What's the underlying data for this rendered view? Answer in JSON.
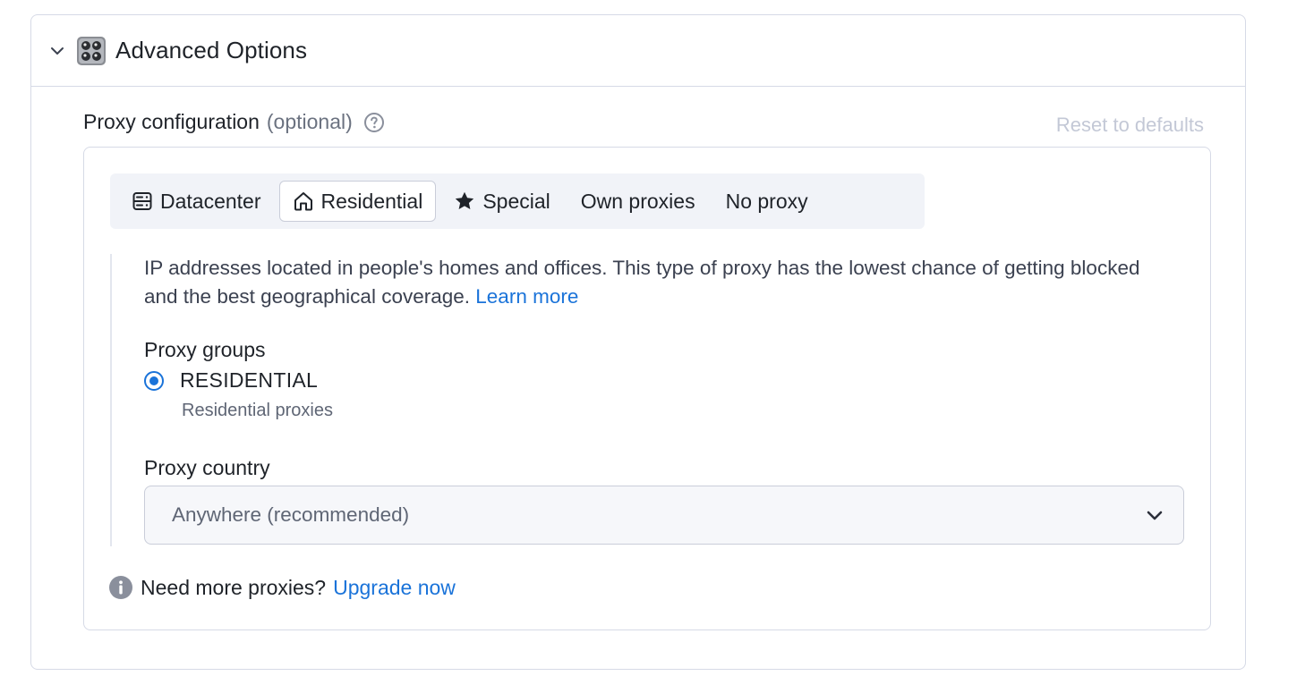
{
  "header": {
    "title": "Advanced Options",
    "icons": {
      "collapse": "chevron-down-icon",
      "logo": "robot-grid-icon"
    }
  },
  "proxy": {
    "label": "Proxy configuration",
    "optional": "(optional)",
    "reset_label": "Reset to defaults",
    "tabs": [
      {
        "label": "Datacenter",
        "icon": "server-icon",
        "active": false
      },
      {
        "label": "Residential",
        "icon": "home-icon",
        "active": true
      },
      {
        "label": "Special",
        "icon": "star-icon",
        "active": false
      },
      {
        "label": "Own proxies",
        "active": false
      },
      {
        "label": "No proxy",
        "active": false
      }
    ],
    "description": "IP addresses located in people's homes and offices. This type of proxy has the lowest chance of getting blocked and the best geographical coverage.",
    "learn_more": "Learn more",
    "groups_label": "Proxy groups",
    "group": {
      "name": "RESIDENTIAL",
      "description": "Residential proxies",
      "selected": true
    },
    "country_label": "Proxy country",
    "country_value": "Anywhere (recommended)",
    "more_text": "Need more proxies?",
    "upgrade_link": "Upgrade now"
  },
  "colors": {
    "accent": "#1a73d9",
    "border": "#d6dae6",
    "muted_text": "#6b7280",
    "disabled_text": "#c3c8d6"
  }
}
